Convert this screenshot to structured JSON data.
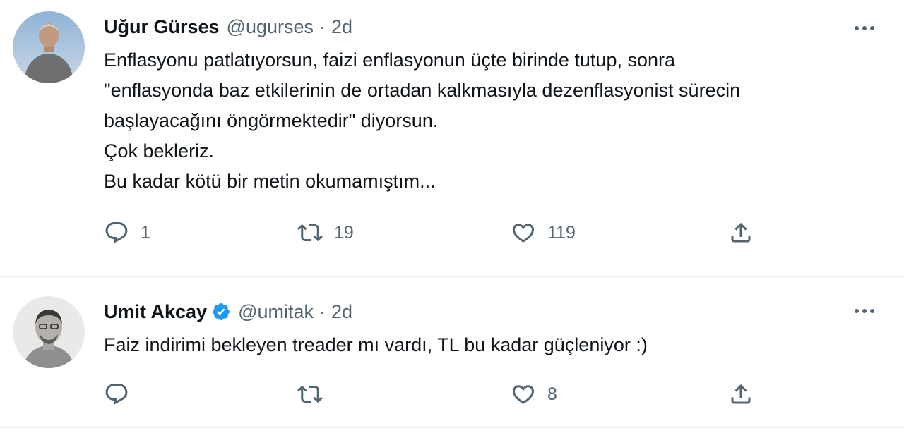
{
  "tweets": [
    {
      "name": "Uğur Gürses",
      "handle": "@ugurses",
      "separator": "·",
      "time": "2d",
      "verified": false,
      "text_lines": [
        "Enflasyonu patlatıyorsun, faizi enflasyonun üçte birinde tutup, sonra",
        "\"enflasyonda baz etkilerinin de ortadan kalkmasıyla dezenflasyonist sürecin",
        "başlayacağını öngörmektedir\" diyorsun.",
        "Çok bekleriz.",
        "Bu kadar kötü bir metin okumamıştım..."
      ],
      "replies": "1",
      "retweets": "19",
      "likes": "119"
    },
    {
      "name": "Umit Akcay",
      "handle": "@umitak",
      "separator": "·",
      "time": "2d",
      "verified": true,
      "text_lines": [
        "Faiz indirimi bekleyen treader mı vardı, TL bu kadar güçleniyor :)"
      ],
      "replies": "",
      "retweets": "",
      "likes": "8"
    }
  ],
  "icons": {
    "reply": "reply-icon",
    "retweet": "retweet-icon",
    "like": "heart-icon",
    "share": "share-icon",
    "more": "more-icon",
    "verified": "verified-badge-icon"
  },
  "colors": {
    "text": "#0f1419",
    "secondary": "#536471",
    "verified": "#1d9bf0",
    "divider": "#e6ecf0"
  }
}
